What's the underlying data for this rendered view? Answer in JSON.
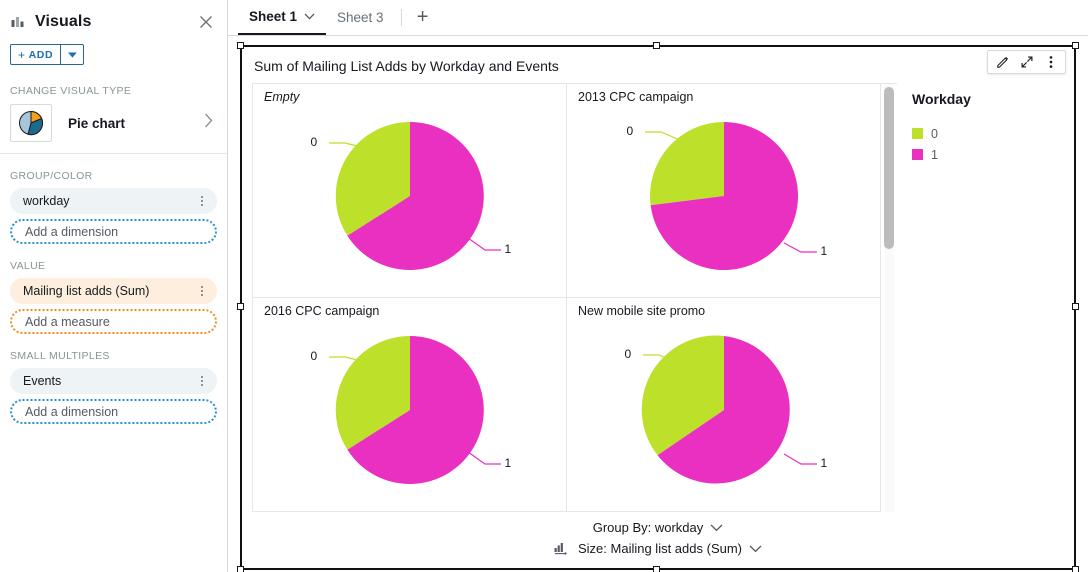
{
  "left_panel": {
    "icon": "bar-chart-icon",
    "title": "Visuals",
    "close_icon": "close-icon",
    "add_button_label": "ADD",
    "add_button_plus": "+",
    "add_caret_icon": "caret-down-icon",
    "change_visual_type_label": "CHANGE VISUAL TYPE",
    "visual_type": {
      "thumb_icon": "pie-chart-icon",
      "label": "Pie chart",
      "chevron_icon": "chevron-right-icon"
    },
    "wells": [
      {
        "section": "GROUP/COLOR",
        "field": "workday",
        "field_kind": "dimension",
        "kebab_icon": "kebab-menu-icon",
        "drop_zone": "Add a dimension",
        "drop_zone_kind": "dimension"
      },
      {
        "section": "VALUE",
        "field": "Mailing list adds (Sum)",
        "field_kind": "measure",
        "kebab_icon": "kebab-menu-icon",
        "drop_zone": "Add a measure",
        "drop_zone_kind": "measure"
      },
      {
        "section": "SMALL MULTIPLES",
        "field": "Events",
        "field_kind": "dimension",
        "kebab_icon": "kebab-menu-icon",
        "drop_zone": "Add a dimension",
        "drop_zone_kind": "dimension"
      }
    ]
  },
  "tab_bar": {
    "tabs": [
      {
        "label": "Sheet 1",
        "active": true,
        "caret_icon": "chevron-down-icon"
      },
      {
        "label": "Sheet 3",
        "active": false
      }
    ],
    "add_tab_icon": "plus-icon",
    "add_tab_glyph": "+"
  },
  "visual": {
    "title": "Sum of Mailing List Adds by Workday and Events",
    "actions": [
      {
        "name": "edit-pencil-icon",
        "glyph": "pencil"
      },
      {
        "name": "expand-icon",
        "glyph": "expand-arrows"
      },
      {
        "name": "menu-kebab-icon",
        "glyph": "vertical-dots"
      }
    ],
    "legend": {
      "title": "Workday",
      "items": [
        {
          "label": "0",
          "color": "#bde02b"
        },
        {
          "label": "1",
          "color": "#e930c0"
        }
      ]
    },
    "footer": {
      "group_by": "Group By: workday",
      "group_by_caret": "chevron-down-icon",
      "size": "Size: Mailing list adds (Sum)",
      "size_caret": "chevron-down-icon",
      "size_icon": "sort-ascending-icon"
    },
    "scrollbar": {
      "name": "vertical-scrollbar",
      "thumb_position_pct": 1
    }
  },
  "chart_data": {
    "type": "pie",
    "title": "Sum of Mailing List Adds by Workday and Events",
    "legend_title": "Workday",
    "legend_position": "right",
    "group_by": "workday",
    "size_measure": "Mailing list adds (Sum)",
    "small_multiples_field": "Events",
    "colors": {
      "0": "#bde02b",
      "1": "#e930c0"
    },
    "panels": [
      {
        "panel_title": "Empty",
        "is_null_panel": true,
        "categories": [
          "0",
          "1"
        ],
        "values": [
          29,
          71
        ],
        "labels": [
          "0",
          "1"
        ]
      },
      {
        "panel_title": "2013 CPC campaign",
        "is_null_panel": false,
        "categories": [
          "0",
          "1"
        ],
        "values": [
          26,
          74
        ],
        "labels": [
          "0",
          "1"
        ]
      },
      {
        "panel_title": "2016 CPC campaign",
        "is_null_panel": false,
        "categories": [
          "0",
          "1"
        ],
        "values": [
          29,
          71
        ],
        "labels": [
          "0",
          "1"
        ]
      },
      {
        "panel_title": "New mobile site promo",
        "is_null_panel": false,
        "categories": [
          "0",
          "1"
        ],
        "values": [
          30,
          70
        ],
        "labels": [
          "0",
          "1"
        ]
      }
    ]
  }
}
